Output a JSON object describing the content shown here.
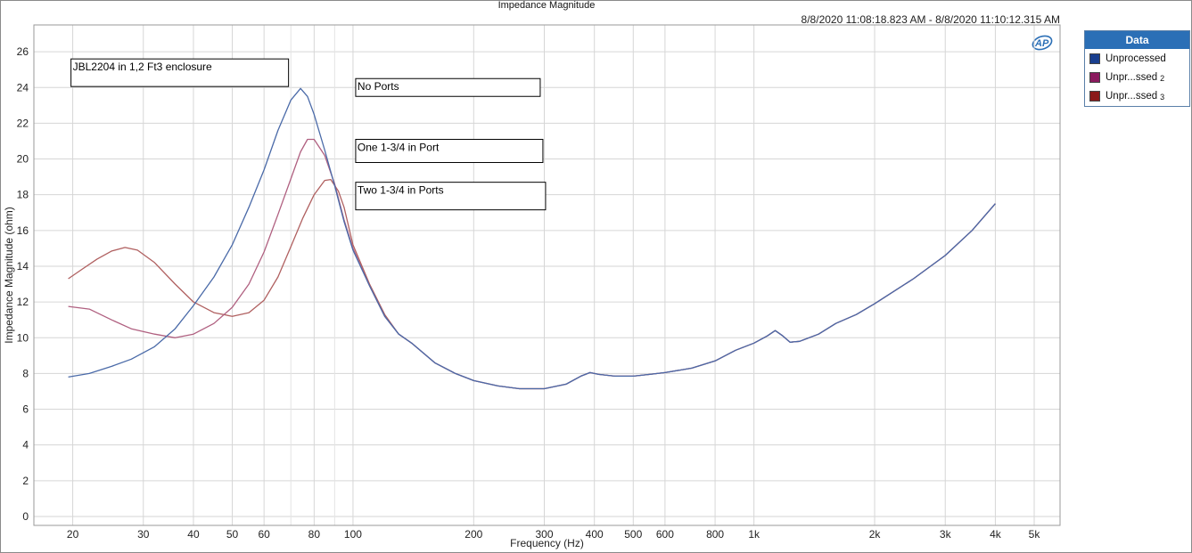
{
  "window": {
    "title": "Impedance Magnitude",
    "time_range": "8/8/2020 11:08:18.823 AM - 8/8/2020 11:10:12.315 AM",
    "logo_text": "AP"
  },
  "legend": {
    "header": "Data",
    "items": [
      {
        "label": "Unprocessed",
        "suffix": "",
        "color": "#1a3f8f"
      },
      {
        "label": "Unpr...ssed",
        "suffix": "2",
        "color": "#8b1a5e"
      },
      {
        "label": "Unpr...ssed",
        "suffix": "3",
        "color": "#8b1a1a"
      }
    ]
  },
  "chart_data": {
    "type": "line",
    "title": "Impedance Magnitude",
    "xlabel": "Frequency (Hz)",
    "ylabel": "Impedance Magnitude (ohm)",
    "x_scale": "log",
    "xlim": [
      16,
      5800
    ],
    "ylim": [
      -0.5,
      27.5
    ],
    "grid": true,
    "legend_position": "right",
    "x_ticks": [
      {
        "value": 20,
        "label": "20"
      },
      {
        "value": 30,
        "label": "30"
      },
      {
        "value": 40,
        "label": "40"
      },
      {
        "value": 50,
        "label": "50"
      },
      {
        "value": 60,
        "label": "60"
      },
      {
        "value": 80,
        "label": "80"
      },
      {
        "value": 100,
        "label": "100"
      },
      {
        "value": 200,
        "label": "200"
      },
      {
        "value": 300,
        "label": "300"
      },
      {
        "value": 400,
        "label": "400"
      },
      {
        "value": 500,
        "label": "500"
      },
      {
        "value": 600,
        "label": "600"
      },
      {
        "value": 800,
        "label": "800"
      },
      {
        "value": 1000,
        "label": "1k"
      },
      {
        "value": 2000,
        "label": "2k"
      },
      {
        "value": 3000,
        "label": "3k"
      },
      {
        "value": 4000,
        "label": "4k"
      },
      {
        "value": 5000,
        "label": "5k"
      }
    ],
    "x_minor_ticks": [
      70,
      90
    ],
    "y_ticks": [
      0,
      2,
      4,
      6,
      8,
      10,
      12,
      14,
      16,
      18,
      20,
      22,
      24,
      26
    ],
    "series": [
      {
        "name": "Unprocessed",
        "color": "#4a6aa8",
        "points": [
          [
            19.5,
            7.8
          ],
          [
            22,
            8.0
          ],
          [
            25,
            8.4
          ],
          [
            28,
            8.8
          ],
          [
            32,
            9.5
          ],
          [
            36,
            10.5
          ],
          [
            40,
            11.8
          ],
          [
            45,
            13.4
          ],
          [
            50,
            15.2
          ],
          [
            55,
            17.3
          ],
          [
            60,
            19.4
          ],
          [
            65,
            21.6
          ],
          [
            70,
            23.3
          ],
          [
            74,
            23.95
          ],
          [
            77,
            23.5
          ],
          [
            80,
            22.5
          ],
          [
            85,
            20.5
          ],
          [
            90,
            18.5
          ],
          [
            95,
            16.5
          ],
          [
            100,
            14.9
          ],
          [
            110,
            12.9
          ],
          [
            120,
            11.2
          ],
          [
            130,
            10.2
          ],
          [
            140,
            9.7
          ],
          [
            160,
            8.6
          ],
          [
            180,
            8.0
          ],
          [
            200,
            7.6
          ],
          [
            230,
            7.3
          ],
          [
            260,
            7.15
          ],
          [
            300,
            7.15
          ],
          [
            340,
            7.4
          ],
          [
            370,
            7.85
          ],
          [
            390,
            8.05
          ],
          [
            410,
            7.95
          ],
          [
            450,
            7.85
          ],
          [
            500,
            7.85
          ],
          [
            550,
            7.95
          ],
          [
            600,
            8.05
          ],
          [
            700,
            8.3
          ],
          [
            800,
            8.7
          ],
          [
            900,
            9.3
          ],
          [
            1000,
            9.7
          ],
          [
            1080,
            10.1
          ],
          [
            1130,
            10.4
          ],
          [
            1180,
            10.1
          ],
          [
            1230,
            9.75
          ],
          [
            1300,
            9.8
          ],
          [
            1450,
            10.2
          ],
          [
            1600,
            10.8
          ],
          [
            1800,
            11.3
          ],
          [
            2000,
            11.9
          ],
          [
            2500,
            13.3
          ],
          [
            3000,
            14.6
          ],
          [
            3500,
            16.0
          ],
          [
            4000,
            17.5
          ]
        ]
      },
      {
        "name": "Unprocessed 2",
        "color": "#b06080",
        "points": [
          [
            19.5,
            11.75
          ],
          [
            22,
            11.6
          ],
          [
            25,
            11.0
          ],
          [
            28,
            10.5
          ],
          [
            32,
            10.2
          ],
          [
            36,
            10.0
          ],
          [
            40,
            10.2
          ],
          [
            45,
            10.8
          ],
          [
            50,
            11.7
          ],
          [
            55,
            13.0
          ],
          [
            60,
            14.8
          ],
          [
            65,
            16.9
          ],
          [
            70,
            18.9
          ],
          [
            74,
            20.4
          ],
          [
            77,
            21.1
          ],
          [
            80,
            21.1
          ],
          [
            85,
            20.2
          ],
          [
            90,
            18.6
          ],
          [
            95,
            16.6
          ],
          [
            100,
            15.0
          ],
          [
            110,
            12.9
          ],
          [
            120,
            11.2
          ],
          [
            130,
            10.2
          ],
          [
            140,
            9.7
          ],
          [
            160,
            8.6
          ],
          [
            180,
            8.0
          ],
          [
            200,
            7.6
          ],
          [
            230,
            7.3
          ],
          [
            260,
            7.15
          ],
          [
            300,
            7.15
          ],
          [
            340,
            7.4
          ],
          [
            370,
            7.85
          ],
          [
            390,
            8.05
          ],
          [
            410,
            7.95
          ],
          [
            450,
            7.85
          ],
          [
            500,
            7.85
          ],
          [
            550,
            7.95
          ],
          [
            600,
            8.05
          ],
          [
            700,
            8.3
          ],
          [
            800,
            8.7
          ],
          [
            900,
            9.3
          ],
          [
            1000,
            9.7
          ],
          [
            1080,
            10.1
          ],
          [
            1130,
            10.4
          ],
          [
            1180,
            10.1
          ],
          [
            1230,
            9.75
          ],
          [
            1300,
            9.8
          ],
          [
            1450,
            10.2
          ],
          [
            1600,
            10.8
          ],
          [
            1800,
            11.3
          ],
          [
            2000,
            11.9
          ],
          [
            2500,
            13.3
          ],
          [
            3000,
            14.6
          ],
          [
            3500,
            16.0
          ],
          [
            4000,
            17.5
          ]
        ]
      },
      {
        "name": "Unprocessed 3",
        "color": "#b06060",
        "points": [
          [
            19.5,
            13.3
          ],
          [
            21,
            13.8
          ],
          [
            23,
            14.4
          ],
          [
            25,
            14.85
          ],
          [
            27,
            15.05
          ],
          [
            29,
            14.9
          ],
          [
            32,
            14.2
          ],
          [
            36,
            13.0
          ],
          [
            40,
            12.0
          ],
          [
            45,
            11.4
          ],
          [
            50,
            11.2
          ],
          [
            55,
            11.4
          ],
          [
            60,
            12.1
          ],
          [
            65,
            13.4
          ],
          [
            70,
            15.1
          ],
          [
            75,
            16.7
          ],
          [
            80,
            18.0
          ],
          [
            85,
            18.8
          ],
          [
            88,
            18.85
          ],
          [
            92,
            18.2
          ],
          [
            95,
            17.3
          ],
          [
            100,
            15.2
          ],
          [
            110,
            13.0
          ],
          [
            120,
            11.3
          ],
          [
            130,
            10.2
          ],
          [
            140,
            9.7
          ],
          [
            160,
            8.6
          ],
          [
            180,
            8.0
          ],
          [
            200,
            7.6
          ],
          [
            230,
            7.3
          ],
          [
            260,
            7.15
          ],
          [
            300,
            7.15
          ],
          [
            340,
            7.4
          ],
          [
            370,
            7.85
          ],
          [
            390,
            8.05
          ],
          [
            410,
            7.95
          ],
          [
            450,
            7.85
          ],
          [
            500,
            7.85
          ],
          [
            550,
            7.95
          ],
          [
            600,
            8.05
          ],
          [
            700,
            8.3
          ],
          [
            800,
            8.7
          ],
          [
            900,
            9.3
          ],
          [
            1000,
            9.7
          ],
          [
            1080,
            10.1
          ],
          [
            1130,
            10.4
          ],
          [
            1180,
            10.1
          ],
          [
            1230,
            9.75
          ],
          [
            1300,
            9.8
          ],
          [
            1450,
            10.2
          ],
          [
            1600,
            10.8
          ],
          [
            1800,
            11.3
          ],
          [
            2000,
            11.9
          ],
          [
            2500,
            13.3
          ],
          [
            3000,
            14.6
          ],
          [
            3500,
            16.0
          ],
          [
            4000,
            17.5
          ]
        ]
      }
    ],
    "annotations": [
      {
        "text": "JBL2204 in 1,2 Ft3 enclosure",
        "x": 19.5,
        "y": 25.2
      },
      {
        "text": "No Ports",
        "x": 100,
        "y": 24.1
      },
      {
        "text": "One 1-3/4 in Port",
        "x": 100,
        "y": 20.7
      },
      {
        "text": "Two 1-3/4 in Ports",
        "x": 100,
        "y": 18.3
      }
    ]
  }
}
